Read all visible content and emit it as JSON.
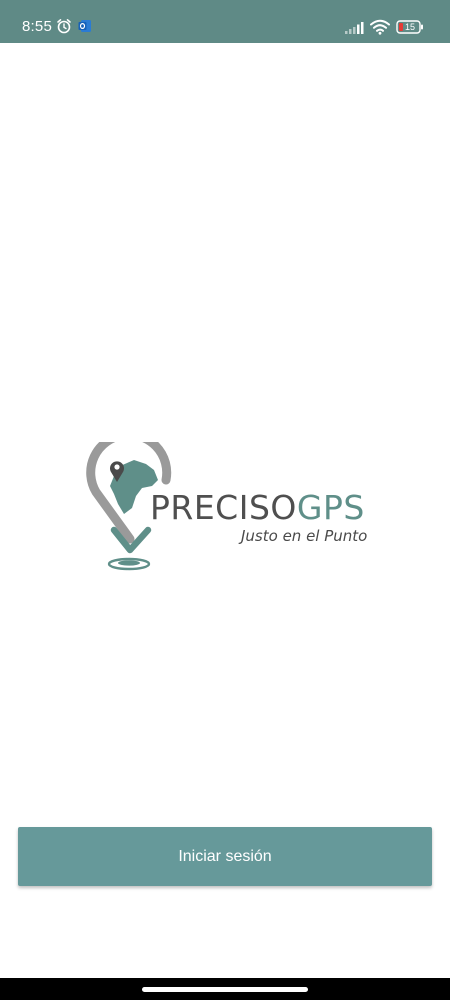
{
  "status_bar": {
    "time": "8:55",
    "icons": [
      "alarm-icon",
      "outlook-icon",
      "signal-icon",
      "wifi-icon",
      "battery-icon"
    ],
    "battery_level": "15",
    "background_color": "#5f8a86"
  },
  "logo": {
    "word_primary": "PRECISO",
    "word_accent": "GPS",
    "tagline": "Justo en el Punto",
    "primary_color": "#4f4f4f",
    "accent_color": "#5f8f89"
  },
  "login": {
    "button_label": "Iniciar sesión",
    "button_color": "#66999a"
  }
}
